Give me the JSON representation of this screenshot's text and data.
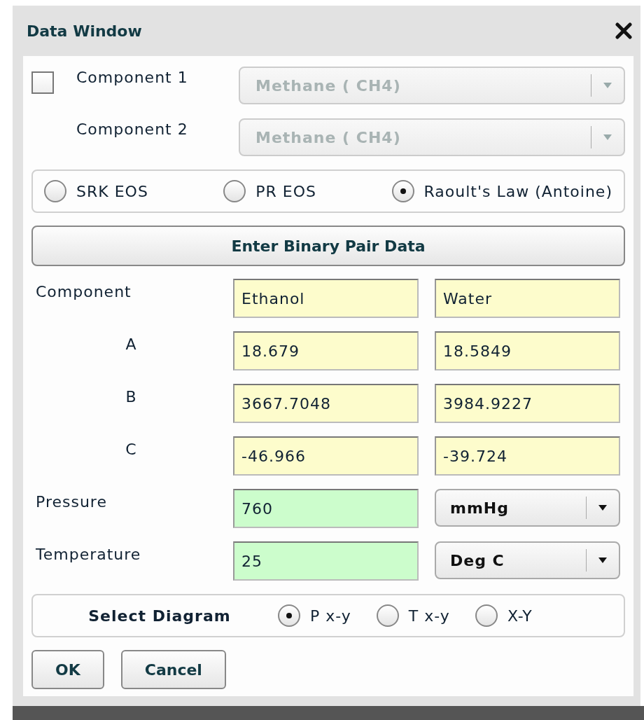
{
  "window": {
    "title": "Data Window"
  },
  "enable_checkbox": {
    "checked": false
  },
  "components": [
    {
      "label": "Component 1",
      "value": "Methane ( CH4)",
      "disabled": true
    },
    {
      "label": "Component 2",
      "value": "Methane ( CH4)",
      "disabled": true
    }
  ],
  "models": [
    {
      "label": "SRK EOS",
      "selected": false
    },
    {
      "label": "PR EOS",
      "selected": false
    },
    {
      "label": "Raoult's Law (Antoine)",
      "selected": true
    }
  ],
  "binary_button": "Enter Binary Pair Data",
  "parameters": [
    {
      "kind": "header",
      "label": "Component",
      "values": [
        "Ethanol",
        "Water"
      ]
    },
    {
      "kind": "constant",
      "label": "A",
      "values": [
        "18.679",
        "18.5849"
      ]
    },
    {
      "kind": "constant",
      "label": "B",
      "values": [
        "3667.7048",
        "3984.9227"
      ]
    },
    {
      "kind": "constant",
      "label": "C",
      "values": [
        "-46.966",
        "-39.724"
      ]
    }
  ],
  "conditions": [
    {
      "label": "Pressure",
      "value": "760",
      "unit": "mmHg"
    },
    {
      "label": "Temperature",
      "value": "25",
      "unit": "Deg C"
    }
  ],
  "diagram": {
    "label": "Select Diagram",
    "options": [
      {
        "label": "P x-y",
        "selected": true
      },
      {
        "label": "T x-y",
        "selected": false
      },
      {
        "label": "X-Y",
        "selected": false
      }
    ]
  },
  "buttons": [
    "OK",
    "Cancel"
  ]
}
